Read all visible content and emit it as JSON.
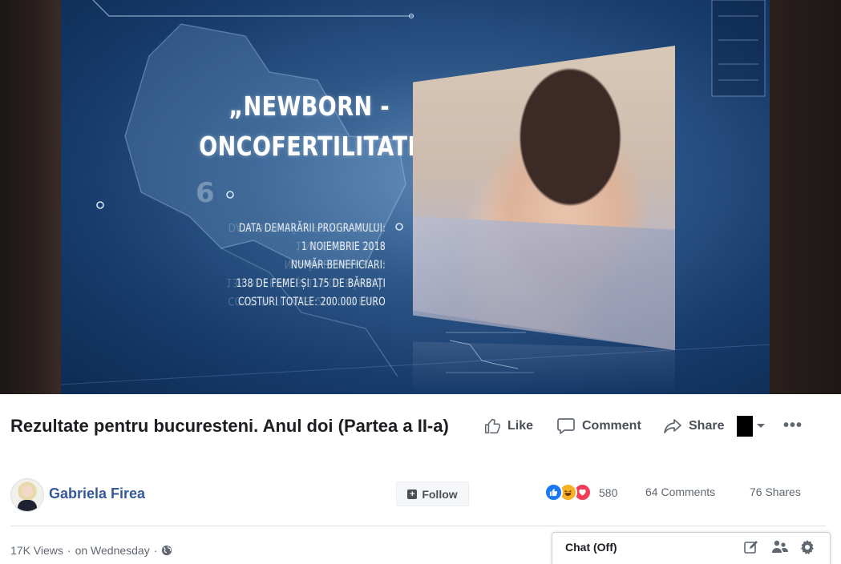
{
  "video": {
    "title": "„NEWBORN -\nONCOFERTILITATE”",
    "map_sector_label": "6",
    "info_lines": [
      "DATA DEMARĂRII PROGRAMULUI:",
      "1 NOIEMBRIE 2018",
      "NUMĂR BENEFICIARI:",
      "138 DE FEMEI ȘI 175 DE BĂRBAȚI",
      "COSTURI TOTALE: 200.000 EURO"
    ]
  },
  "post": {
    "title": "Rezultate pentru bucuresteni. Anul doi (Partea a II-a)",
    "actions": {
      "like": "Like",
      "comment": "Comment",
      "share": "Share",
      "more": "•••"
    },
    "author": {
      "name": "Gabriela Firea"
    },
    "follow_label": "Follow",
    "reactions": {
      "types": [
        "like",
        "haha",
        "love"
      ],
      "count": "580"
    },
    "comments_count": "64 Comments",
    "shares_count": "76 Shares",
    "meta": {
      "views": "17K Views",
      "separator": "·",
      "date": "on Wednesday",
      "privacy_icon": "globe-icon"
    }
  },
  "chat": {
    "label": "Chat (Off)",
    "icons": [
      "compose-icon",
      "people-icon",
      "settings-icon"
    ]
  },
  "colors": {
    "author_link": "#365899",
    "like_blue": "#1877f2",
    "love_red": "#f33e58",
    "haha_yellow": "#f7b125",
    "video_bg": "#163a6a"
  }
}
